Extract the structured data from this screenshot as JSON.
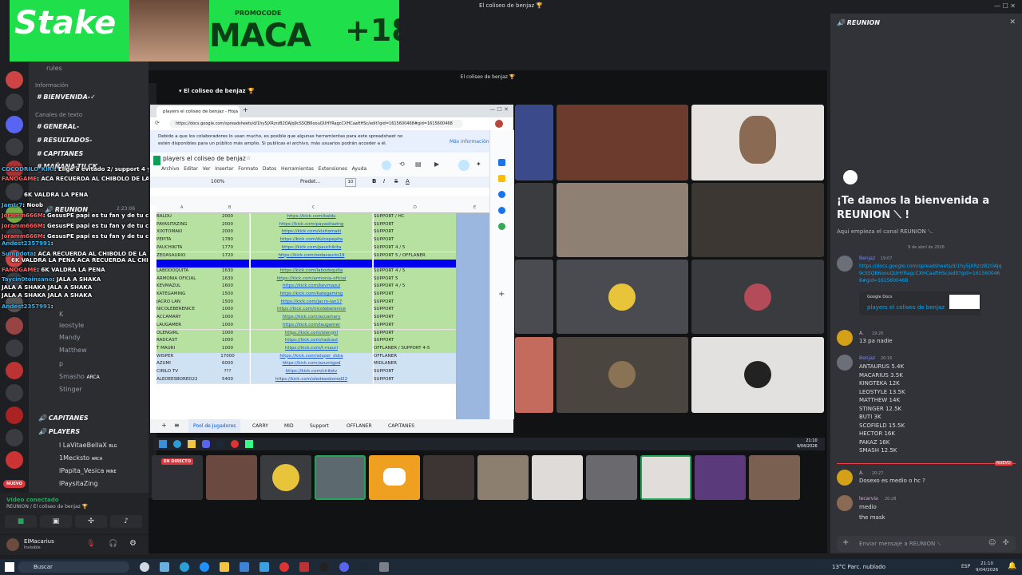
{
  "window": {
    "title": "El coliseo de benjaz 🏆",
    "inner_title": "El coliseo de benjaz 🏆"
  },
  "banner": {
    "brand": "Stake",
    "promo_label": "PROMOCODE",
    "promo_code": "MACA",
    "age": "+18"
  },
  "channels": {
    "rules": "rules",
    "info_category": "Información",
    "items": [
      "BIENVENIDA-✓",
      "GENERAL-",
      "RESULTADOS-",
      "CAPITANES",
      "MAÑANA-TILCK"
    ],
    "text_category": "Canales de texto",
    "voice_reunion": "REUNION",
    "voice_capitanes": "CAPITANES",
    "voice_players": "PLAYERS",
    "members": [
      "K",
      "leostyle",
      "Mandy",
      "Matthew",
      "p",
      "Smasho",
      "Stinger",
      "ARCA",
      "l LaVitaeBellaX",
      "1Mecksto",
      "lPapita_Vesica",
      "lPaysitaZing"
    ],
    "member_tags": [
      "BLG",
      "ARCA",
      "MINE"
    ],
    "time": "2:23:06"
  },
  "chat_overlay": [
    {
      "user": "COCODRILO_KIRI",
      "text": "Elige a evitado 2/ support 4 y 5 y carry"
    },
    {
      "user": "FANOGAME",
      "text": "ACA RECUERDA AL CHIBOLO DE LA MAÑANA FANOGAME"
    },
    {
      "user": "",
      "text": "6K VALDRA LA PENA"
    },
    {
      "user": "Jamtr7",
      "text": "Noob"
    },
    {
      "user": "Joramm666M",
      "text": "GesusPE papi es tu fan y de tu cuidad mano"
    },
    {
      "user": "Joramm666M",
      "text": "GesusPE papi es tu fan y de tu cuidad mano"
    },
    {
      "user": "Joramm666M",
      "text": "GesusPE papi es tu fan y de tu cuidad mano"
    },
    {
      "user": "Andest2357991",
      "text": ""
    },
    {
      "user": "Sumpdota",
      "text": "ACA RECUERDA AL CHIBOLO DE LA MAÑANA"
    },
    {
      "user": "",
      "text": "6K VALDRA LA PENA ACA RECUERDA AL CHIBOLO DE LA MAÑANA"
    },
    {
      "user": "FANOGAME",
      "text": "6K VALDRA LA PENA"
    },
    {
      "user": "Taycin0toinsano",
      "text": "JALA A SHAKA"
    },
    {
      "user": "JALA A SHAKA",
      "text": "JALA A SHAKA"
    },
    {
      "user": "JALA A SHAKA",
      "text": "JALA A SHAKA"
    },
    {
      "user": "Andest2357991",
      "text": ""
    }
  ],
  "voice": {
    "status": "Vídeo conectado",
    "channel": "REUNION / El coliseo de benjaz 🏆"
  },
  "user": {
    "name": "ElMacarius",
    "status": "Invisible"
  },
  "browser": {
    "tab_title": "players el coliseo de benjaz - Hoja",
    "url": "https://docs.google.com/spreadsheets/d/1hy5jXRzrzB2OAJq9cSSQB6oouQUHYRagcCXHCaaftHSc/edit?gid=1615600468#gid=1615600468",
    "notice": "Debido a que los colaboradores lo usan mucho, es posible que algunas herramientas para este spreadsheet no estén disponibles para un público más amplio. Si publicas el archivo, más usuarios podrán acceder a él.",
    "notice_link": "Más información",
    "doc_title": "players el coliseo de benjaz",
    "menu": [
      "Archivo",
      "Editar",
      "Ver",
      "Insertar",
      "Formato",
      "Datos",
      "Herramientas",
      "Extensiones",
      "Ayuda"
    ],
    "zoom": "100%",
    "font": "Predet...",
    "font_size": "10",
    "col_headers": [
      "A",
      "B",
      "C",
      "D",
      "E"
    ],
    "rows": [
      {
        "name": "BALDU",
        "mmr": "2000",
        "link": "https://kick.com/baldu",
        "role": "SUPPORT / HC",
        "color": "#b7e1a1"
      },
      {
        "name": "PAYASITAZING",
        "mmr": "2000",
        "link": "https://kick.com/payasitazing",
        "role": "SUPPORT",
        "color": "#b7e1a1"
      },
      {
        "name": "XIXITOMAKI",
        "mmr": "2000",
        "link": "https://kick.com/xixitomaki",
        "role": "SUPPORT",
        "color": "#b7e1a1"
      },
      {
        "name": "PEPITA",
        "mmr": "1780",
        "link": "https://kick.com/dulcepepita",
        "role": "SUPPORT",
        "color": "#b7e1a1"
      },
      {
        "name": "PAUCHIKITA",
        "mmr": "1770",
        "link": "https://kick.com/pauchikita",
        "role": "SUPPORT 4 / 5",
        "color": "#b7e1a1"
      },
      {
        "name": "ZEDASAURIO",
        "mmr": "1720",
        "link": "https://kick.com/zedasaurio19",
        "role": "SUPPORT 5 / OFFLANER",
        "color": "#b7e1a1"
      },
      {
        "name": "",
        "mmr": "",
        "link": "",
        "role": "",
        "color": "#0000ee"
      },
      {
        "name": "LABODOQUITA",
        "mmr": "1630",
        "link": "https://kick.com/labodoquita",
        "role": "SUPPORT 4 / 5",
        "color": "#b7e1a1"
      },
      {
        "name": "ARMONIA OFICIAL",
        "mmr": "1630",
        "link": "https://kick.com/armonia-oficial",
        "role": "SUPPORT 5",
        "color": "#b7e1a1"
      },
      {
        "name": "KEVMAZUL",
        "mmr": "1600",
        "link": "https://kick.com/kevmazul",
        "role": "SUPPORT 4 / 5",
        "color": "#b7e1a1"
      },
      {
        "name": "KATEGAMING",
        "mmr": "1500",
        "link": "https://kick.com/kategaming",
        "role": "SUPPORT",
        "color": "#b7e1a1"
      },
      {
        "name": "JACRO LAN",
        "mmr": "1500",
        "link": "https://kick.com/jacro-lan17",
        "role": "SUPPORT",
        "color": "#b7e1a1"
      },
      {
        "name": "NICOLEBERENICE",
        "mmr": "1000",
        "link": "https://kick.com/nicoleberenice",
        "role": "SUPPORT",
        "color": "#b7e1a1"
      },
      {
        "name": "ACCAMARY",
        "mmr": "1000",
        "link": "https://kick.com/accamary",
        "role": "SUPPORT",
        "color": "#b7e1a1"
      },
      {
        "name": "LAUGAMER",
        "mmr": "1000",
        "link": "https://kick.com/laugamer",
        "role": "SUPPORT",
        "color": "#b7e1a1"
      },
      {
        "name": "OLENGIRL",
        "mmr": "1000",
        "link": "https://kick.com/olengirl",
        "role": "SUPPORT",
        "color": "#b7e1a1"
      },
      {
        "name": "RADCAST",
        "mmr": "1000",
        "link": "https://kick.com/radcast",
        "role": "SUPPORT",
        "color": "#b7e1a1"
      },
      {
        "name": "T MAURI",
        "mmr": "1000",
        "link": "https://kick.com/t-mauri",
        "role": "OFFLANER / SUPPORT 4-5",
        "color": "#b7e1a1"
      },
      {
        "name": "WISPER",
        "mmr": "17000",
        "link": "https://kick.com/wisper_dota",
        "role": "OFFLANER",
        "color": "#cfe2f3"
      },
      {
        "name": "AZUMI",
        "mmr": "6000",
        "link": "https://kick.com/azumigod",
        "role": "MIDLANER",
        "color": "#cfe2f3"
      },
      {
        "name": "CIRILO TV",
        "mmr": "???",
        "link": "https://kick.com/cirilotv",
        "role": "SUPPORT",
        "color": "#cfe2f3"
      },
      {
        "name": "ALEDEESBORED22",
        "mmr": "5400",
        "link": "https://kick.com/aledeesbored22",
        "role": "SUPPORT",
        "color": "#cfe2f3"
      }
    ],
    "sheet_tabs": [
      "Pool de Jugadores",
      "CARRY",
      "MID",
      "Support",
      "OFFLANER",
      "CAPITANES"
    ]
  },
  "inner_taskbar": {
    "time": "21:10",
    "date": "9/04/2026"
  },
  "live_label": "EN DIRECTO",
  "right_panel": {
    "channel": "REUNION",
    "welcome_title": "¡Te damos la bienvenida a REUNION ⟍ !",
    "welcome_sub": "Aquí empieza el canal REUNION ⟍.",
    "date_divider": "9 de abril de 2026",
    "messages": [
      {
        "user": "Benjaz",
        "time": "19:07",
        "text": "https://docs.google.com/spreadsheets/d/1hy5jXRzrzB2OAJq9cSSQB6oouQUHYRagcCXHCaaftHSc/edit?gid=1615600468#gid=1615600468"
      },
      {
        "user": "A.",
        "time": "19:26",
        "text": "13 pa nadie"
      },
      {
        "user": "Benjaz",
        "time": "20:16",
        "text": "ANTAURUS 5.4K"
      }
    ],
    "embed_provider": "Google Docs",
    "embed_title": "players el coliseo de benjaz",
    "list": [
      "ANTAURUS 5.4K",
      "MACARIUS 3.5K",
      "KINGTEKA 12K",
      "LEOSTYLE 13.5K",
      "MATTHEW 14K",
      "STINGER 12.5K",
      "BUTI 3K",
      "SCOFIELD 15.5K",
      "HECTOR 16K",
      "PAKAZ 16K",
      "SMASH 12.5K"
    ],
    "new_badge": "NUEVO",
    "msg2_user": "A.",
    "msg2_time": "20:27",
    "msg2_text": "Dosexo es medio o hc ?",
    "msg3_user": "lecarvia",
    "msg3_time": "20:28",
    "msg3_line1": "medio",
    "msg3_line2": "the mask",
    "input_placeholder": "Enviar mensaje a REUNION ⟍"
  },
  "taskbar": {
    "search": "Buscar",
    "weather": "13°C Parc. nublado",
    "lang": "ESP",
    "time": "21:10",
    "date": "9/04/2026"
  }
}
